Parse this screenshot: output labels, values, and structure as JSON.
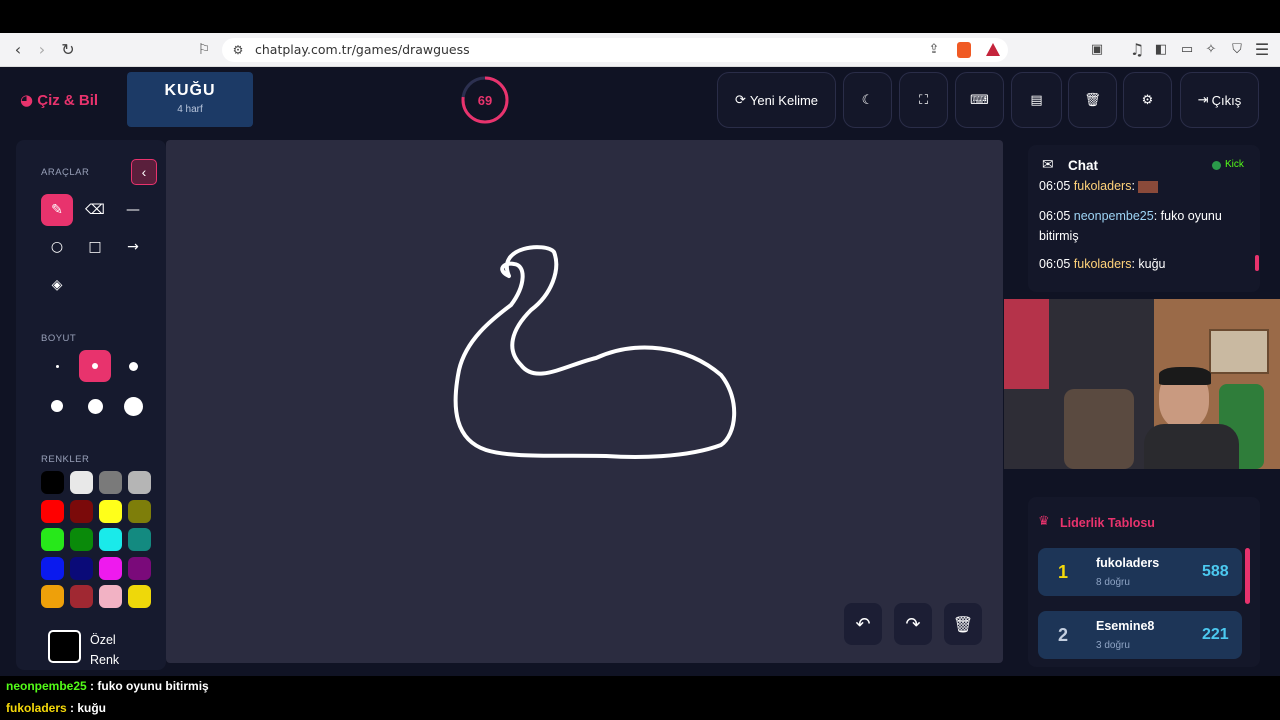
{
  "browser": {
    "url": "chatplay.com.tr/games/drawguess"
  },
  "app": {
    "logo": "Çiz & Bil",
    "word": "KUĞU",
    "word_hint": "4 harf",
    "timer_value": "69",
    "timer_fraction": 0.77,
    "buttons": {
      "new_word": "Yeni Kelime",
      "exit": "Çıkış"
    }
  },
  "tools": {
    "title": "ARAÇLAR",
    "size_title": "BOYUT",
    "colors_title": "RENKLER",
    "custom_color_line1": "Özel",
    "custom_color_line2": "Renk",
    "colors": [
      "#000000",
      "#e8e8e8",
      "#7a7a7a",
      "#b5b5b5",
      "#ff0000",
      "#7b0a0a",
      "#ffff1a",
      "#7e7e0a",
      "#27e81a",
      "#0a8a0a",
      "#1aeaea",
      "#138a80",
      "#0a1aee",
      "#0a0a78",
      "#ee1aee",
      "#7a0a7a",
      "#eea00a",
      "#a02832",
      "#f2b2c4",
      "#eed80a"
    ]
  },
  "chat": {
    "title": "Chat",
    "platform": "Kick",
    "messages": [
      {
        "time": "06:05",
        "user": "fukoladers",
        "text": ""
      },
      {
        "time": "06:05",
        "user": "neonpembe25",
        "text": "fuko oyunu bitirmiş"
      },
      {
        "time": "06:05",
        "user": "fukoladers",
        "text": "kuğu"
      }
    ]
  },
  "leaderboard": {
    "title": "Liderlik Tablosu",
    "rows": [
      {
        "rank": "1",
        "name": "fukoladers",
        "sub": "8 doğru",
        "score": "588"
      },
      {
        "rank": "2",
        "name": "Esemine8",
        "sub": "3 doğru",
        "score": "221"
      }
    ]
  },
  "overlay": {
    "lines": [
      {
        "user": "neonpembe25",
        "text": " : fuko oyunu bitirmiş"
      },
      {
        "user": "fukoladers",
        "text": " : kuğu"
      }
    ]
  }
}
